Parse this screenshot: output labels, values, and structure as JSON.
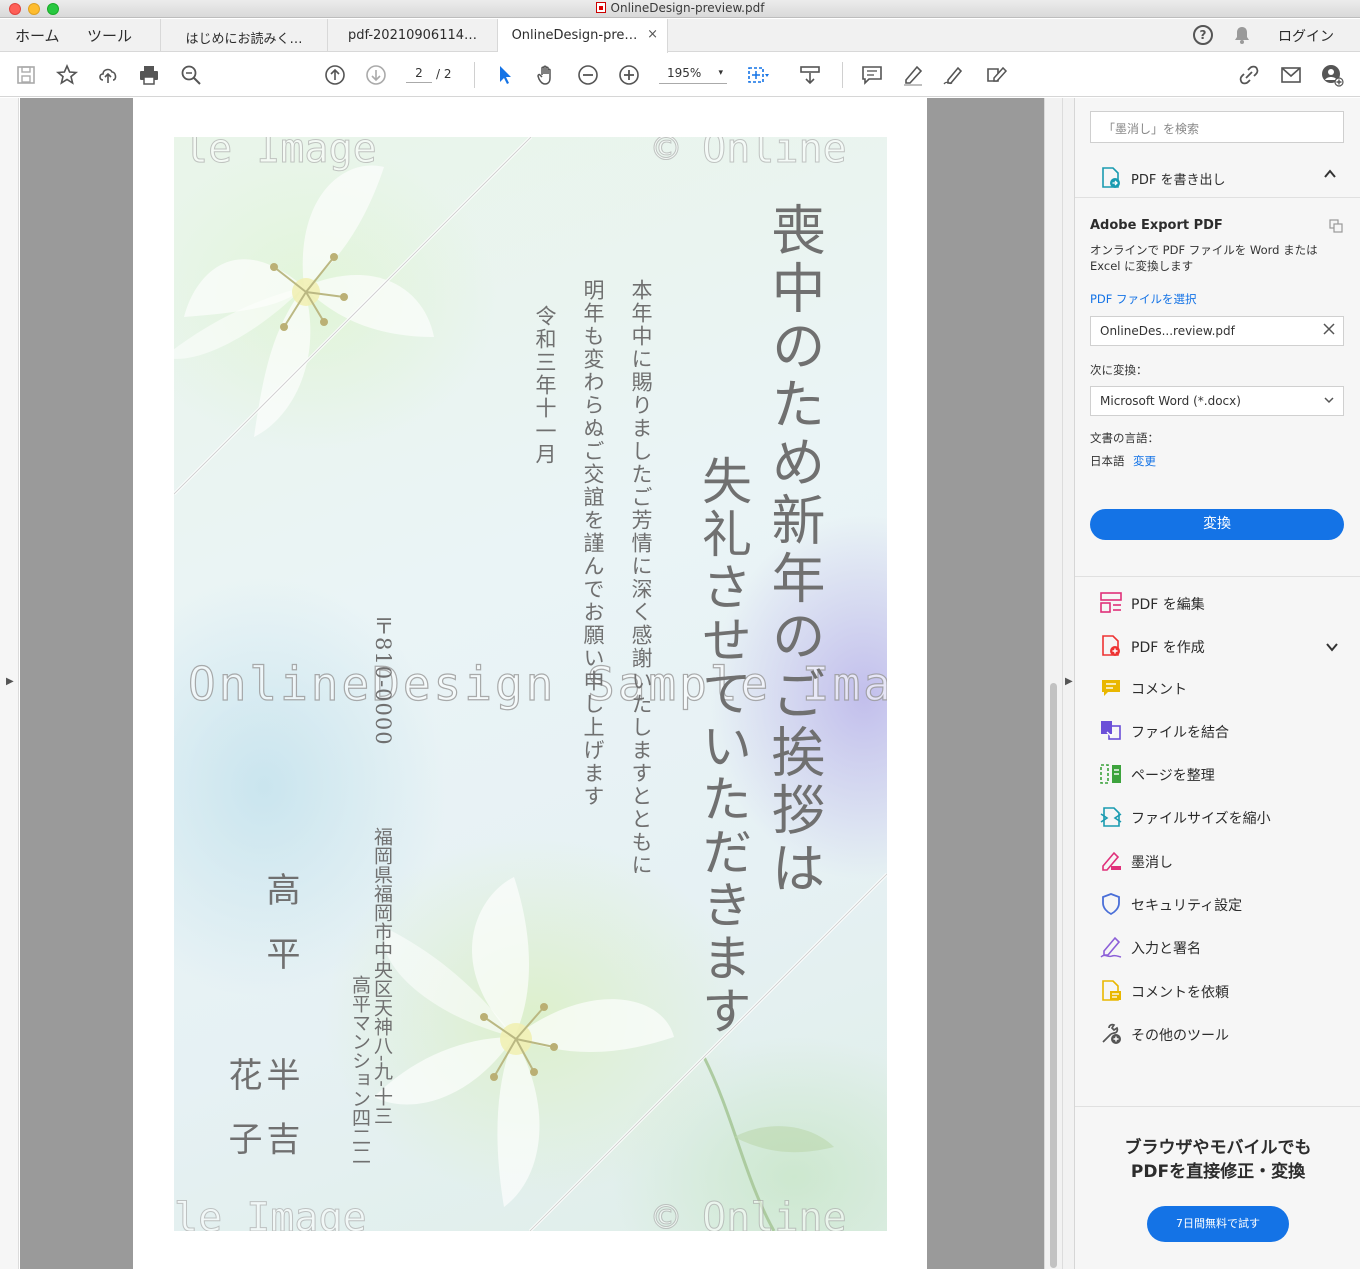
{
  "window": {
    "title": "OnlineDesign-preview.pdf"
  },
  "nav": {
    "home": "ホーム",
    "tools": "ツール",
    "login": "ログイン"
  },
  "tabs": [
    {
      "label": "はじめにお読みく…"
    },
    {
      "label": "pdf-20210906114…"
    },
    {
      "label": "OnlineDesign-pre…",
      "close": "×"
    }
  ],
  "toolbar": {
    "page_current": "2",
    "page_total": "/ 2",
    "zoom": "195%",
    "zoom_caret": "▾"
  },
  "document": {
    "title_line1": "喪中のため新年のご挨拶は",
    "title_line2": "失礼させていただきます",
    "body_line1": "本年中に賜りましたご芳情に深く感謝いたしますとともに",
    "body_line2": "明年も変わらぬご交誼を謹んでお願い申し上げます",
    "date": "令和三年十一月",
    "postal": "〒810-0000",
    "address1": "福岡県福岡市中央区天神八-九-十三",
    "address2": "高平マンション四二二",
    "surname": "高平",
    "given1": "半吉",
    "given2": "花子",
    "watermark": "OnlineDesign Sample Image"
  },
  "right_panel": {
    "search_placeholder": "「墨消し」を検索",
    "export_header": "PDF を書き出し",
    "export_title": "Adobe Export PDF",
    "export_desc": "オンラインで PDF ファイルを Word または Excel に変換します",
    "select_file_link": "PDF ファイルを選択",
    "file_name": "OnlineDes...review.pdf",
    "convert_to_label": "次に変換：",
    "convert_format": "Microsoft Word (*.docx)",
    "lang_label": "文書の言語：",
    "lang_value": "日本語",
    "lang_change": "変更",
    "convert_button": "変換",
    "tools": [
      {
        "label": "PDF を編集",
        "icon": "edit-pdf-icon",
        "color": "#e0307a"
      },
      {
        "label": "PDF を作成",
        "icon": "create-pdf-icon",
        "color": "#e33"
      },
      {
        "label": "コメント",
        "icon": "comment-icon",
        "color": "#e9b700"
      },
      {
        "label": "ファイルを結合",
        "icon": "combine-icon",
        "color": "#6b4fd8"
      },
      {
        "label": "ページを整理",
        "icon": "organize-icon",
        "color": "#3da33d"
      },
      {
        "label": "ファイルサイズを縮小",
        "icon": "compress-icon",
        "color": "#1a9bb0"
      },
      {
        "label": "墨消し",
        "icon": "redact-icon",
        "color": "#e0307a"
      },
      {
        "label": "セキュリティ設定",
        "icon": "shield-icon",
        "color": "#4a6fd8"
      },
      {
        "label": "入力と署名",
        "icon": "sign-icon",
        "color": "#8c5fd8"
      },
      {
        "label": "コメントを依頼",
        "icon": "request-comment-icon",
        "color": "#e9b700"
      },
      {
        "label": "その他のツール",
        "icon": "more-tools-icon",
        "color": "#555"
      }
    ],
    "promo_line1": "ブラウザやモバイルでも",
    "promo_line2": "PDFを直接修正・変換",
    "promo_button": "7日間無料で試す"
  }
}
